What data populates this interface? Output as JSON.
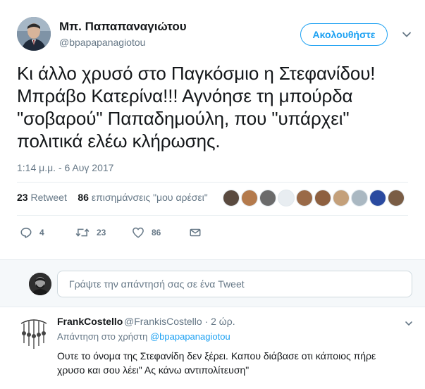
{
  "tweet": {
    "author_name": "Μπ. Παπαπαναγιώτου",
    "author_handle": "@bpapapanagiotou",
    "follow_label": "Ακολουθήστε",
    "text_lines": [
      "Κι άλλο χρυσό στο Παγκόσμιο η Στεφανίδου!",
      "Μπράβο Κατερίνα!!! Αγνόησε τη μπούρδα",
      "\"σοβαρού\" Παπαδημούλη, που \"υπάρχει\"",
      "πολιτικά ελέω κλήρωσης."
    ],
    "timestamp": "1:14 μ.μ. - 6 Αυγ 2017",
    "retweet_count": "23",
    "retweet_label": "Retweet",
    "like_count": "86",
    "like_label": "επισημάνσεις \"μου αρέσει\"",
    "actions": {
      "reply_count": "4",
      "retweet_count": "23",
      "like_count": "86"
    }
  },
  "likers": [
    {
      "color": "#5a4a3f"
    },
    {
      "color": "#b47a4c"
    },
    {
      "color": "#6b6b6b"
    },
    {
      "color": "#e8edf1"
    },
    {
      "color": "#9a6a48"
    },
    {
      "color": "#8e6040"
    },
    {
      "color": "#c4a07a"
    },
    {
      "color": "#aab8c2"
    },
    {
      "color": "#2a4aa0"
    },
    {
      "color": "#7a5d45"
    }
  ],
  "reply_box": {
    "placeholder": "Γράψτε την απάντησή σας σε ένα Tweet"
  },
  "reply": {
    "author_name": "FrankCostello",
    "author_handle": "@FrankisCostello · 2 ώρ.",
    "reply_to_label": "Απάντηση στο χρήστη",
    "reply_to_handle": "@bpapapanagiotou",
    "text_lines": [
      "Ουτε το όνομα της Στεφανίδη δεν ξέρει. Καπου διάβασε οτι κάποιος πήρε",
      "χρυσο και σου λέει\" Ας κάνω αντιπολίτευση\""
    ]
  },
  "colors": {
    "accent": "#1da1f2",
    "secondary_text": "#657786",
    "like_icon": "#657786"
  }
}
